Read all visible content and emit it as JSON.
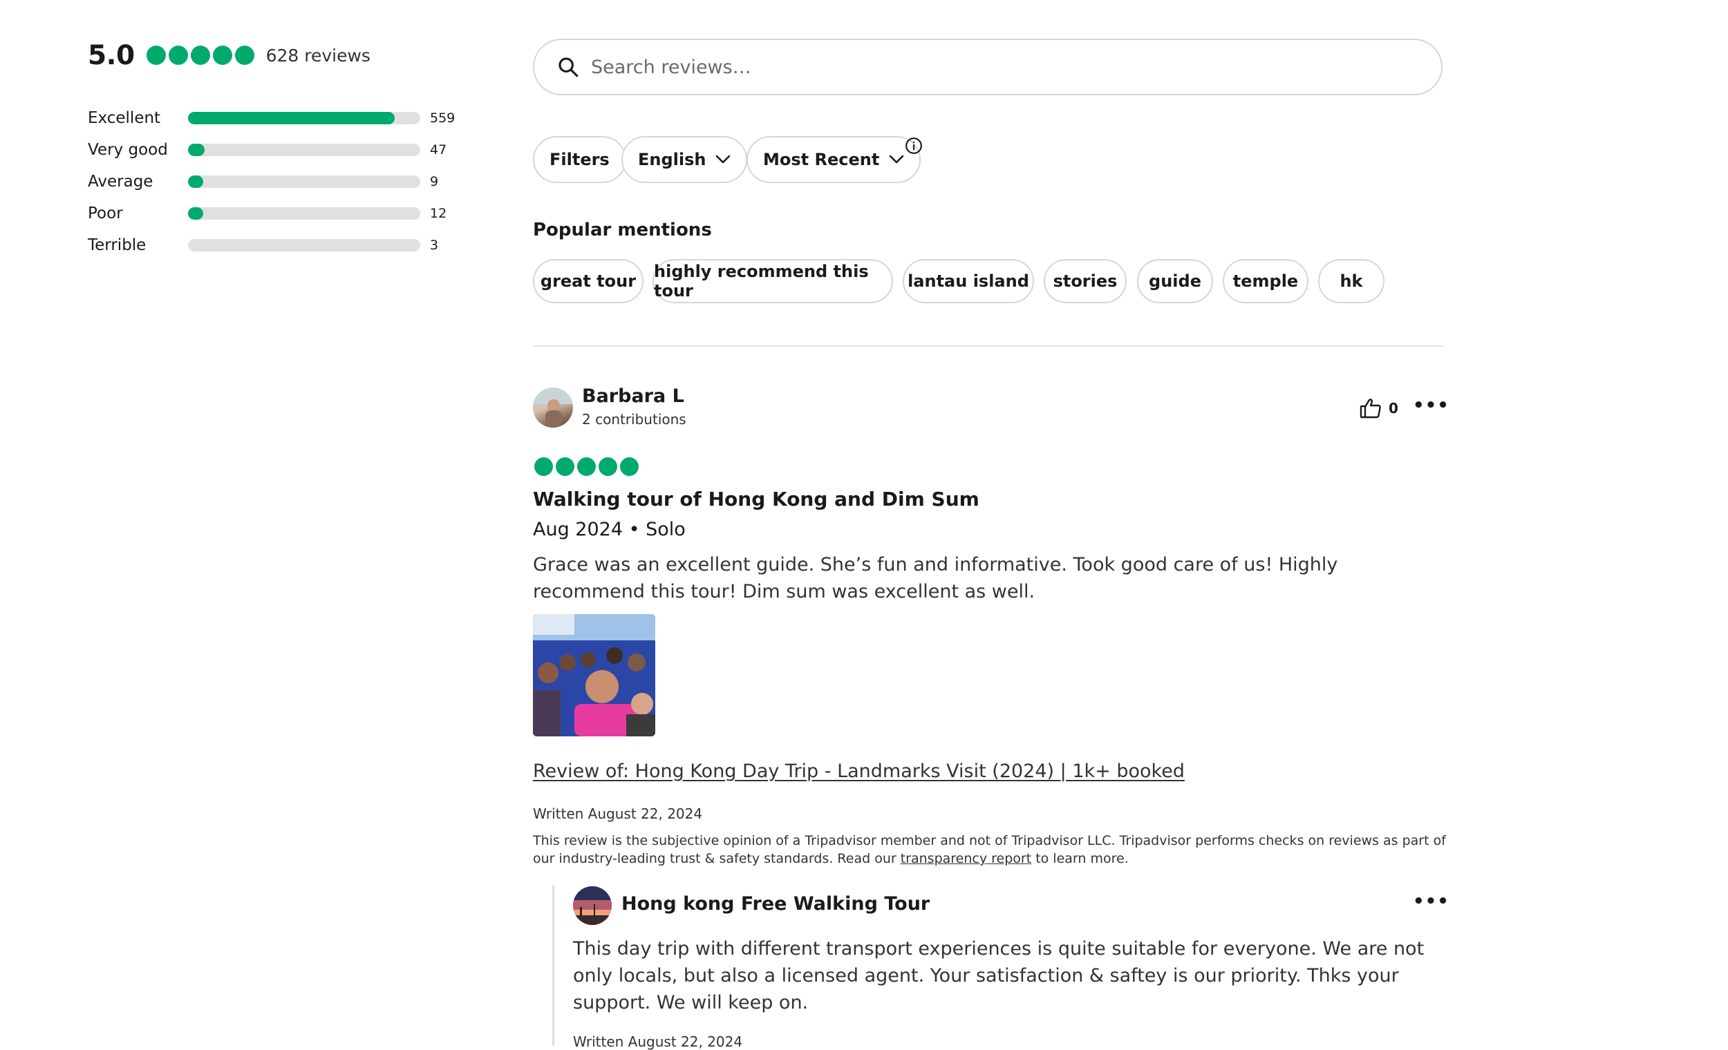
{
  "summary": {
    "score": "5.0",
    "bubbles_filled": 5,
    "review_count": "628 reviews",
    "breakdown": [
      {
        "label": "Excellent",
        "count": "559",
        "fraction": 0.89
      },
      {
        "label": "Very good",
        "count": "47",
        "fraction": 0.07
      },
      {
        "label": "Average",
        "count": "9",
        "fraction": 0.065
      },
      {
        "label": "Poor",
        "count": "12",
        "fraction": 0.065
      },
      {
        "label": "Terrible",
        "count": "3",
        "fraction": 0.0
      }
    ]
  },
  "search": {
    "placeholder": "Search reviews…",
    "icon": "search-icon"
  },
  "filters": {
    "filters_label": "Filters",
    "language_label": "English",
    "sort_label": "Most Recent",
    "info_icon": "info-icon"
  },
  "popular_mentions": {
    "title": "Popular mentions",
    "chips": [
      "great tour",
      "highly recommend this tour",
      "lantau island",
      "stories",
      "guide",
      "temple",
      "hk"
    ]
  },
  "review": {
    "author": "Barbara L",
    "contributions": "2 contributions",
    "helpful_count": "0",
    "rating": 5,
    "title": "Walking tour of Hong Kong and Dim Sum",
    "meta": "Aug 2024 • Solo",
    "body": "Grace was an excellent guide. She’s fun and informative. Took good care of us! Highly recommend this tour! Dim sum was excellent as well.",
    "review_of": "Review of: Hong Kong Day Trip - Landmarks Visit (2024) | 1k+ booked",
    "written": "Written August 22, 2024",
    "disclaimer_before": "This review is the subjective opinion of a Tripadvisor member and not of Tripadvisor LLC. Tripadvisor performs checks on reviews as part of our industry-leading trust & safety standards. Read our ",
    "disclaimer_link": "transparency report",
    "disclaimer_after": " to learn more."
  },
  "response": {
    "owner_name": "Hong kong Free Walking Tour",
    "body": "This day trip with different transport experiences is quite suitable for everyone. We are not only locals, but also a licensed agent. Your satisfaction & saftey is our priority. Thks your support. We will keep on.",
    "written": "Written August 22, 2024"
  },
  "colors": {
    "brand_green": "#00aa6c",
    "track_gray": "#e0e0e0",
    "border_gray": "#d6d6d6"
  }
}
